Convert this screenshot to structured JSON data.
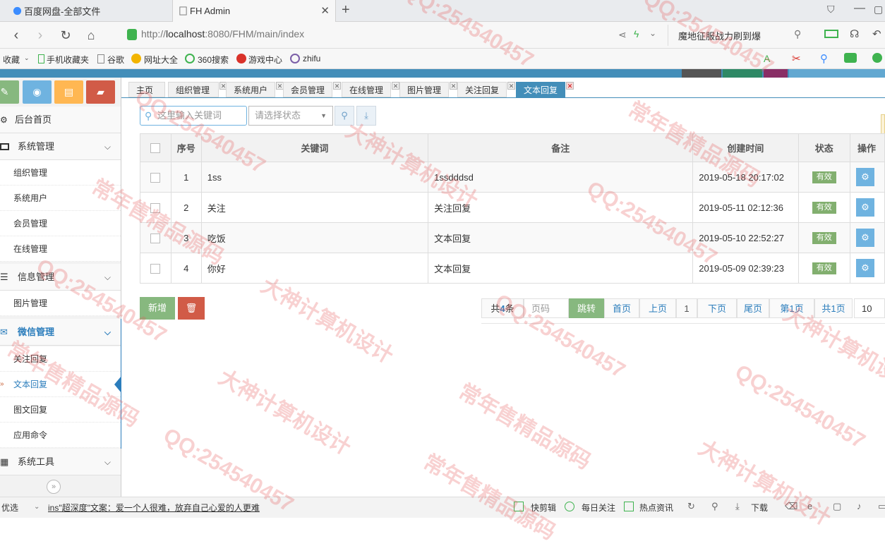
{
  "browser": {
    "tabs": [
      {
        "title": "百度网盘-全部文件"
      },
      {
        "title": "FH Admin"
      }
    ],
    "url_prefix": "http://",
    "url_host": "localhost",
    "url_rest": ":8080/FHM/main/index",
    "search_box": "魔地征服战力刷到爆",
    "bookmarks": [
      "收藏",
      "手机收藏夹",
      "谷歌",
      "网址大全",
      "360搜索",
      "游戏中心",
      "zhifu"
    ]
  },
  "sidebar": {
    "home": "后台首页",
    "groups": [
      {
        "label": "系统管理",
        "items": [
          "组织管理",
          "系统用户",
          "会员管理",
          "在线管理"
        ]
      },
      {
        "label": "信息管理",
        "items": [
          "图片管理"
        ]
      },
      {
        "label": "微信管理",
        "items": [
          "关注回复",
          "文本回复",
          "图文回复",
          "应用命令"
        ]
      },
      {
        "label": "系统工具",
        "items": []
      }
    ]
  },
  "content_tabs": [
    "主页",
    "组织管理",
    "系统用户",
    "会员管理",
    "在线管理",
    "图片管理",
    "关注回复",
    "文本回复"
  ],
  "toolbar": {
    "search_placeholder": "这里输入关键词",
    "status_placeholder": "请选择状态"
  },
  "table": {
    "headers": [
      "序号",
      "关键词",
      "备注",
      "创建时间",
      "状态",
      "操作"
    ],
    "rows": [
      {
        "no": "1",
        "keyword": "1ss",
        "remark": "1ssdddsd",
        "created": "2019-05-18 20:17:02",
        "status": "有效"
      },
      {
        "no": "2",
        "keyword": "关注",
        "remark": "关注回复",
        "created": "2019-05-11 02:12:36",
        "status": "有效"
      },
      {
        "no": "3",
        "keyword": "吃饭",
        "remark": "文本回复",
        "created": "2019-05-10 22:52:27",
        "status": "有效"
      },
      {
        "no": "4",
        "keyword": "你好",
        "remark": "文本回复",
        "created": "2019-05-09 02:39:23",
        "status": "有效"
      }
    ]
  },
  "actions": {
    "add": "新增"
  },
  "pagination": {
    "total_prefix": "共",
    "total_count": "4",
    "total_suffix": "条",
    "page_placeholder": "页码",
    "jump": "跳转",
    "first": "首页",
    "prev": "上页",
    "current": "1",
    "next": "下页",
    "last": "尾页",
    "page_no": "第1页",
    "page_total": "共1页",
    "page_size": "10"
  },
  "statusbar": {
    "left": "优选",
    "news": "ins\"超深度\"文案：爱一个人很难，放弃自己心爱的人更难",
    "items": [
      "快剪辑",
      "每日关注",
      "热点资讯",
      "下载"
    ]
  },
  "watermarks": [
    "QQ:254540457",
    "大神计算机设计",
    "常年售精品源码"
  ],
  "colors": {
    "accent": "#438eb9",
    "active_badge": "#82af6f",
    "add": "#87b87f",
    "delete": "#d15b47"
  }
}
